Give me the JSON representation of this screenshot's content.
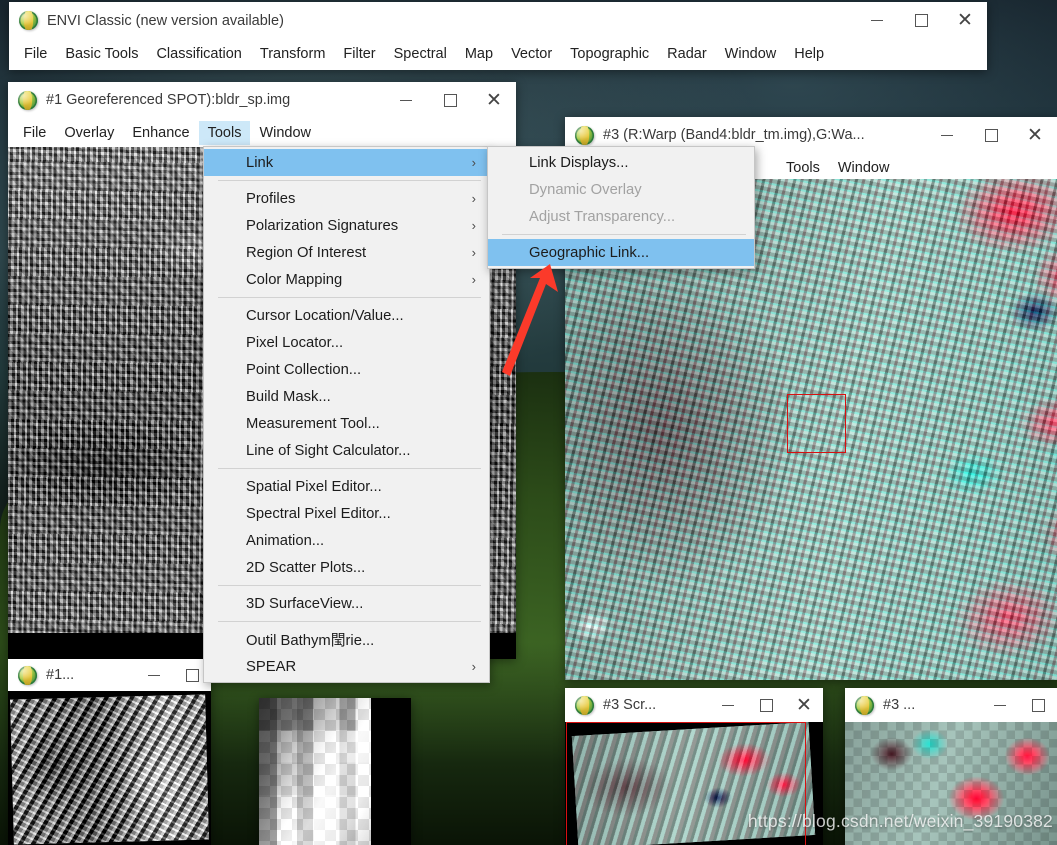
{
  "desktop": {
    "wallpaper_name": "green-hill-wallpaper"
  },
  "main_window": {
    "icon": "envi-globe-icon",
    "title": "ENVI Classic (new version available)",
    "controls": {
      "minimize": "minimize-icon",
      "maximize": "maximize-icon",
      "close": "close-icon"
    },
    "menus": [
      "File",
      "Basic Tools",
      "Classification",
      "Transform",
      "Filter",
      "Spectral",
      "Map",
      "Vector",
      "Topographic",
      "Radar",
      "Window",
      "Help"
    ]
  },
  "window1": {
    "icon": "envi-globe-icon",
    "title": "#1 Georeferenced SPOT):bldr_sp.img",
    "menus": [
      "File",
      "Overlay",
      "Enhance",
      "Tools",
      "Window"
    ],
    "active_menu": "Tools",
    "image_name": "bldr_sp-grayscale-spot-image"
  },
  "tools_menu": {
    "items": [
      {
        "label": "Link",
        "submenu": true,
        "selected": true,
        "disabled": false
      },
      {
        "separator": true
      },
      {
        "label": "Profiles",
        "submenu": true,
        "selected": false,
        "disabled": false
      },
      {
        "label": "Polarization Signatures",
        "submenu": true,
        "selected": false,
        "disabled": false
      },
      {
        "label": "Region Of Interest",
        "submenu": true,
        "selected": false,
        "disabled": false
      },
      {
        "label": "Color Mapping",
        "submenu": true,
        "selected": false,
        "disabled": false
      },
      {
        "separator": true
      },
      {
        "label": "Cursor Location/Value...",
        "submenu": false,
        "selected": false,
        "disabled": false
      },
      {
        "label": "Pixel Locator...",
        "submenu": false,
        "selected": false,
        "disabled": false
      },
      {
        "label": "Point Collection...",
        "submenu": false,
        "selected": false,
        "disabled": false
      },
      {
        "label": "Build Mask...",
        "submenu": false,
        "selected": false,
        "disabled": false
      },
      {
        "label": "Measurement Tool...",
        "submenu": false,
        "selected": false,
        "disabled": false
      },
      {
        "label": "Line of Sight Calculator...",
        "submenu": false,
        "selected": false,
        "disabled": false
      },
      {
        "separator": true
      },
      {
        "label": "Spatial Pixel Editor...",
        "submenu": false,
        "selected": false,
        "disabled": false
      },
      {
        "label": "Spectral Pixel Editor...",
        "submenu": false,
        "selected": false,
        "disabled": false
      },
      {
        "label": "Animation...",
        "submenu": false,
        "selected": false,
        "disabled": false
      },
      {
        "label": "2D Scatter Plots...",
        "submenu": false,
        "selected": false,
        "disabled": false
      },
      {
        "separator": true
      },
      {
        "label": "3D SurfaceView...",
        "submenu": false,
        "selected": false,
        "disabled": false
      },
      {
        "separator": true
      },
      {
        "label": "Outil Bathym閠rie...",
        "submenu": false,
        "selected": false,
        "disabled": false
      },
      {
        "label": "SPEAR",
        "submenu": true,
        "selected": false,
        "disabled": false
      }
    ],
    "arrow_glyph": "›"
  },
  "link_submenu": {
    "items": [
      {
        "label": "Link Displays...",
        "selected": false,
        "disabled": false
      },
      {
        "label": "Dynamic Overlay",
        "selected": false,
        "disabled": true
      },
      {
        "label": "Adjust Transparency...",
        "selected": false,
        "disabled": true
      },
      {
        "separator": true
      },
      {
        "label": "Geographic Link...",
        "selected": true,
        "disabled": false
      }
    ]
  },
  "window3": {
    "icon": "envi-globe-icon",
    "title": "#3 (R:Warp (Band4:bldr_tm.img),G:Wa...",
    "menus": [
      "Tools",
      "Window"
    ],
    "image_name": "bldr_tm-false-color-composite",
    "roi_box_color": "#d81010"
  },
  "window1_scroll": {
    "icon": "envi-globe-icon",
    "title": "#1...",
    "image_name": "bldr_sp-scroll-terrain-grayscale"
  },
  "window1_zoom": {
    "image_name": "bldr_sp-zoom-pixelated-grayscale"
  },
  "window3_scroll": {
    "icon": "envi-globe-icon",
    "title": "#3 Scr...",
    "image_name": "bldr_tm-scroll-false-color",
    "roi_box_color": "#e81010"
  },
  "window3_zoom": {
    "icon": "envi-globe-icon",
    "title": "#3 ...",
    "image_name": "bldr_tm-zoom-pixelated-false-color"
  },
  "annotation": {
    "arrow_name": "red-pointer-arrow",
    "arrow_color": "#fb3a2a",
    "points_to": "Geographic Link..."
  },
  "watermark": {
    "text": "https://blog.csdn.net/weixin_39190382"
  }
}
